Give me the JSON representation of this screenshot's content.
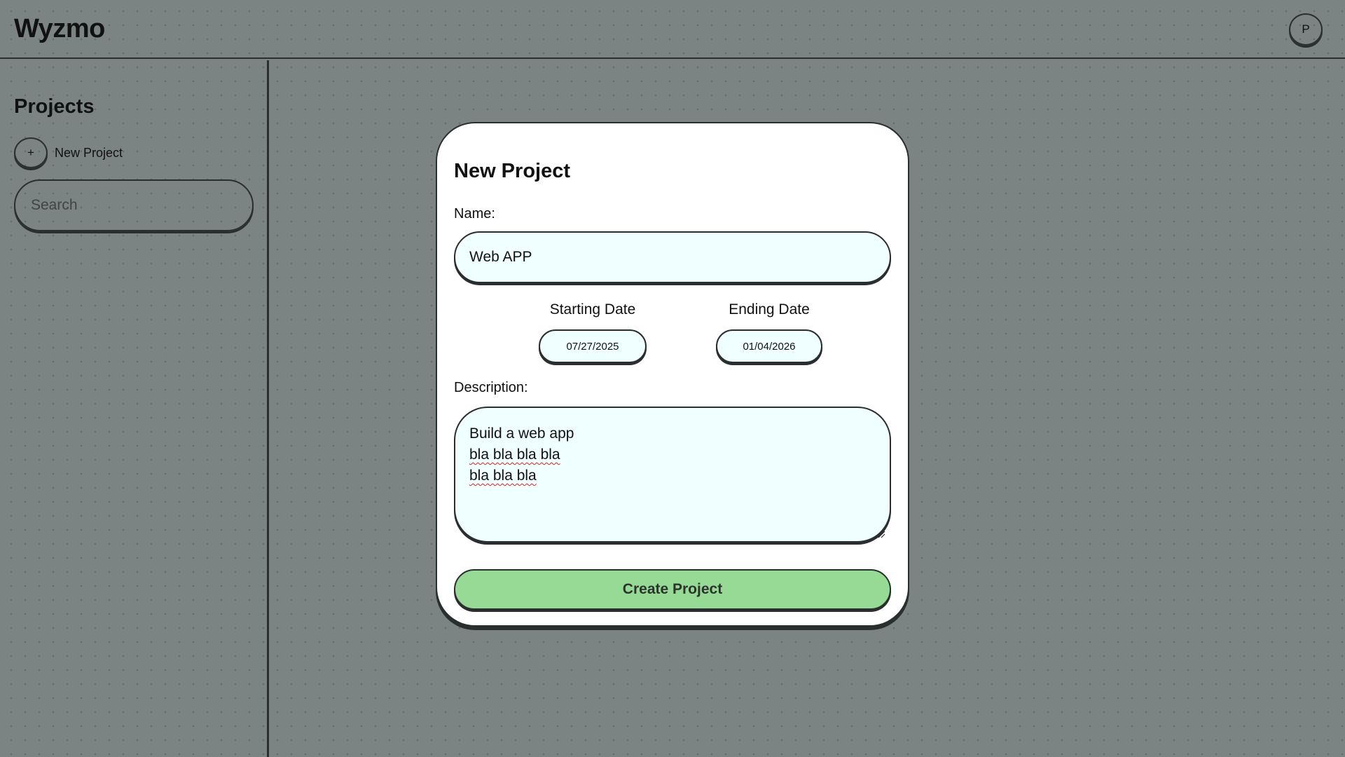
{
  "header": {
    "logo": "Wyzmo",
    "avatar_initial": "P"
  },
  "sidebar": {
    "title": "Projects",
    "new_project_icon": "+",
    "new_project_label": "New Project",
    "search_placeholder": "Search"
  },
  "modal": {
    "title": "New Project",
    "name_label": "Name:",
    "name_value": "Web APP",
    "start_date_label": "Starting Date",
    "start_date_value": "07/27/2025",
    "end_date_label": "Ending Date",
    "end_date_value": "01/04/2026",
    "description_label": "Description:",
    "description_lines": {
      "line1": "Build a web app",
      "line2": "bla bla bla bla",
      "line3": "bla bla bla"
    },
    "submit_label": "Create Project"
  },
  "colors": {
    "background": "#7b8383",
    "card": "#ffffff",
    "input_fill": "#f0ffff",
    "submit_button": "#96da96",
    "border": "#2a2e2e"
  },
  "icons": {
    "new_project": "plus-icon",
    "resize": "resize-handle-icon"
  }
}
